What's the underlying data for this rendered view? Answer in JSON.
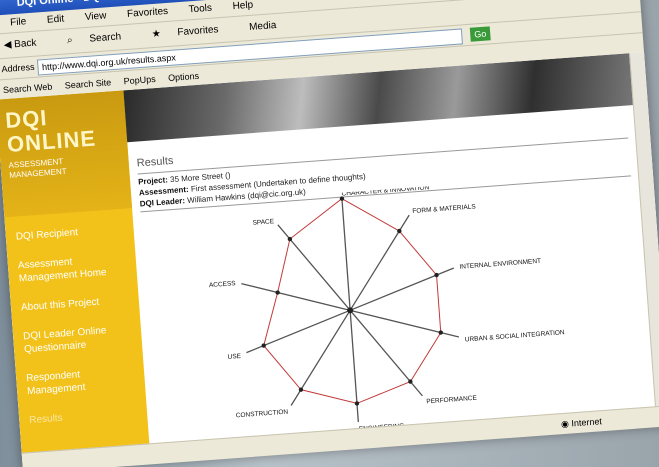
{
  "window": {
    "title": "DQI Online - DQI Leader Area - Results - Microsoft Internet Explorer"
  },
  "menu": [
    "File",
    "Edit",
    "View",
    "Favorites",
    "Tools",
    "Help"
  ],
  "toolbar": {
    "back": "Back",
    "search": "Search",
    "favorites": "Favorites",
    "media": "Media"
  },
  "address": {
    "label": "Address",
    "url": "http://www.dqi.org.uk/results.aspx",
    "go": "Go"
  },
  "links": [
    "Search Web",
    "Search Site",
    "PopUps",
    "Options"
  ],
  "sidebar": {
    "logo_title_1": "DQI",
    "logo_title_2": "ONLINE",
    "logo_sub": "ASSESSMENT MANAGEMENT",
    "items": [
      "DQI Recipient",
      "Assessment Management Home",
      "About this Project",
      "DQI Leader Online Questionnaire",
      "Respondent Management",
      "Results"
    ]
  },
  "page": {
    "results_title": "Results",
    "project_label": "Project:",
    "project_value": "35 More Street ()",
    "assessment_label": "Assessment:",
    "assessment_value": "First assessment (Undertaken to define thoughts)",
    "leader_label": "DQI Leader:",
    "leader_value": "William Hawkins (dqi@cic.org.uk)"
  },
  "chart_data": {
    "type": "radar",
    "categories": [
      "CHARACTER & INNOVATION",
      "FORM & MATERIALS",
      "INTERNAL ENVIRONMENT",
      "URBAN & SOCIAL INTEGRATION",
      "PERFORMANCE",
      "ENGINEERING",
      "CONSTRUCTION",
      "USE",
      "ACCESS",
      "SPACE"
    ],
    "values": [
      6,
      5,
      5,
      5,
      5,
      5,
      5,
      5,
      4,
      5
    ],
    "rlim": [
      0,
      6
    ],
    "colors": {
      "axis": "#555555",
      "polygon": "#c23a3a",
      "point": "#222222"
    }
  },
  "status": {
    "zone": "Internet"
  }
}
